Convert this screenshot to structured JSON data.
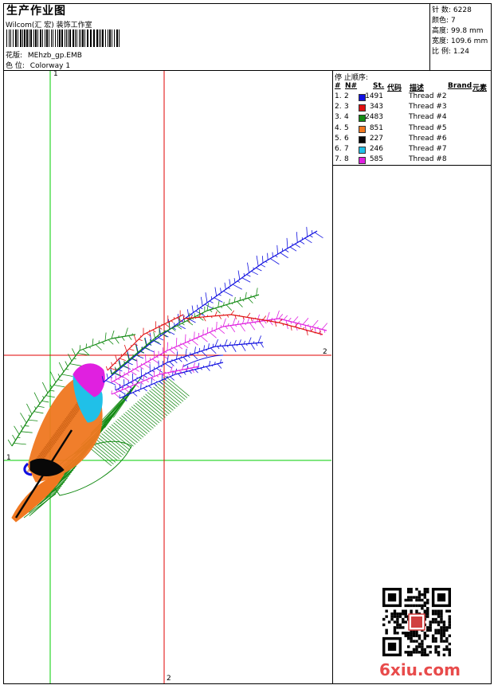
{
  "header": {
    "title": "生产作业图",
    "company": "Wilcom(汇 宏) 装饰工作室",
    "design_label": "花版:",
    "design_value": "MEhzb_gp.EMB",
    "colorway_label": "色 位:",
    "colorway_value": "Colorway 1"
  },
  "stats": [
    {
      "label": "针 数:",
      "value": "6228"
    },
    {
      "label": "颜色:",
      "value": "7"
    },
    {
      "label": "高度:",
      "value": "99.8 mm"
    },
    {
      "label": "宽度:",
      "value": "109.6 mm"
    },
    {
      "label": "比 例:",
      "value": "1.24"
    }
  ],
  "stop_sequence": {
    "title": "停 止顺序:",
    "columns": {
      "num": "#",
      "needle": "N#",
      "stitches": "St.",
      "code": "代码",
      "desc": "描述",
      "brand": "Brand",
      "element": "元素"
    },
    "rows": [
      {
        "num": "1.",
        "needle": "2",
        "color": "#1010e0",
        "stitches": "1491",
        "desc": "Thread #2"
      },
      {
        "num": "2.",
        "needle": "3",
        "color": "#e01010",
        "stitches": "343",
        "desc": "Thread #3"
      },
      {
        "num": "3.",
        "needle": "4",
        "color": "#138a13",
        "stitches": "2483",
        "desc": "Thread #4"
      },
      {
        "num": "4.",
        "needle": "5",
        "color": "#f07820",
        "stitches": "851",
        "desc": "Thread #5"
      },
      {
        "num": "5.",
        "needle": "6",
        "color": "#080808",
        "stitches": "227",
        "desc": "Thread #6"
      },
      {
        "num": "6.",
        "needle": "7",
        "color": "#20c0e8",
        "stitches": "246",
        "desc": "Thread #7"
      },
      {
        "num": "7.",
        "needle": "8",
        "color": "#e020e0",
        "stitches": "585",
        "desc": "Thread #8"
      }
    ]
  },
  "axis_labels": {
    "green_v": "1",
    "green_h": "1",
    "red_h": "2",
    "red_v": "2"
  },
  "watermark": "6xiu.com",
  "colors": {
    "green_axis": "#00cc00",
    "red_axis": "#e00000"
  }
}
